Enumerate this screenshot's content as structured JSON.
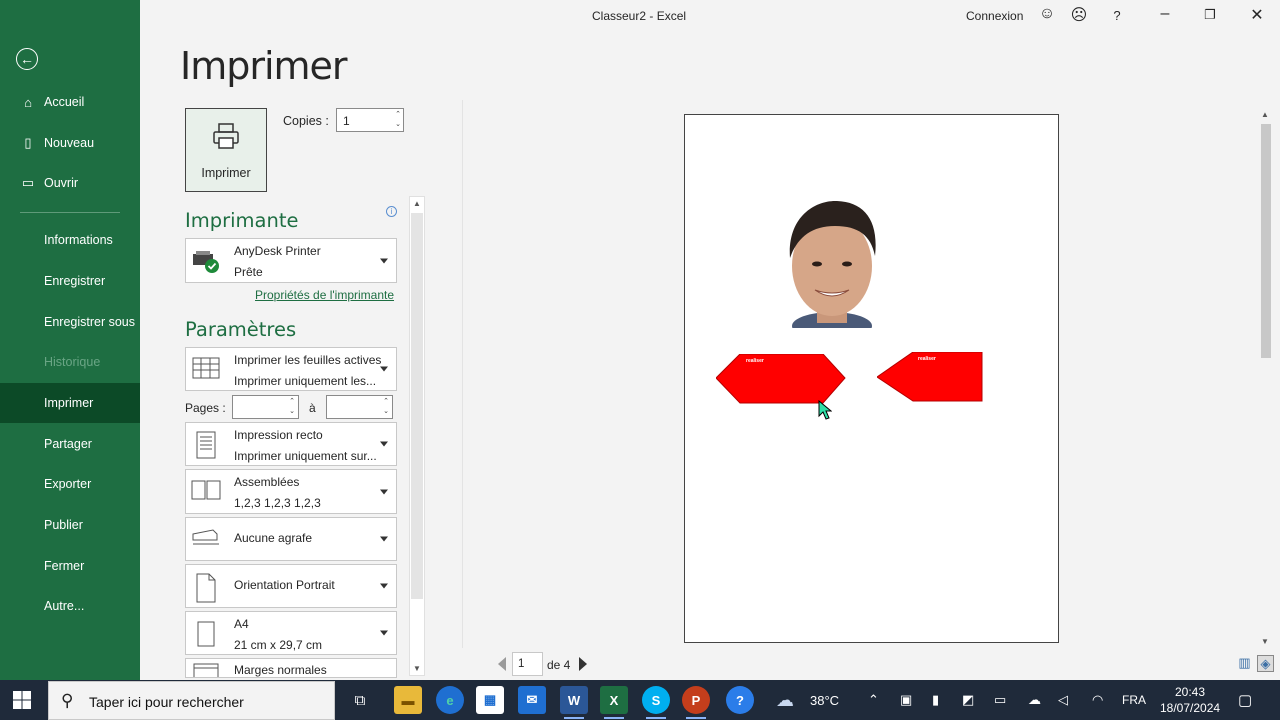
{
  "window": {
    "title": "Classeur2  -  Excel",
    "signin": "Connexion",
    "help": "?"
  },
  "sidebar": {
    "items": [
      {
        "label": "Accueil",
        "icon": "home-icon"
      },
      {
        "label": "Nouveau",
        "icon": "new-file-icon"
      },
      {
        "label": "Ouvrir",
        "icon": "folder-icon"
      },
      {
        "label": "Informations"
      },
      {
        "label": "Enregistrer"
      },
      {
        "label": "Enregistrer sous"
      },
      {
        "label": "Historique",
        "disabled": true
      },
      {
        "label": "Imprimer",
        "active": true
      },
      {
        "label": "Partager"
      },
      {
        "label": "Exporter"
      },
      {
        "label": "Publier"
      },
      {
        "label": "Fermer"
      },
      {
        "label": "Autre..."
      }
    ]
  },
  "print": {
    "heading": "Imprimer",
    "button_label": "Imprimer",
    "copies_label": "Copies :",
    "copies_value": "1",
    "printer_section": "Imprimante",
    "printer_name": "AnyDesk Printer",
    "printer_status": "Prête",
    "printer_properties": "Propriétés de l'imprimante",
    "settings_section": "Paramètres",
    "what": {
      "l1": "Imprimer les feuilles actives",
      "l2": "Imprimer uniquement les..."
    },
    "pages_label": "Pages :",
    "pages_to": "à",
    "sides": {
      "l1": "Impression recto",
      "l2": "Imprimer uniquement sur..."
    },
    "collate": {
      "l1": "Assemblées",
      "l2": "1,2,3    1,2,3    1,2,3"
    },
    "staple": {
      "l1": "Aucune agrafe"
    },
    "orientation": {
      "l1": "Orientation Portrait"
    },
    "paper": {
      "l1": "A4",
      "l2": "21 cm x 29,7 cm"
    },
    "margins": {
      "l1": "Marges normales"
    }
  },
  "preview": {
    "shape_label": "realiser",
    "current_page": "1",
    "total_pages": "de 4",
    "shape_color": "#ff0000"
  },
  "taskbar": {
    "search_placeholder": "Taper ici pour rechercher",
    "weather": "38°C",
    "language": "FRA",
    "time": "20:43",
    "date": "18/07/2024"
  },
  "colors": {
    "accent": "#1e6e42",
    "active_nav": "#0c4a27"
  }
}
